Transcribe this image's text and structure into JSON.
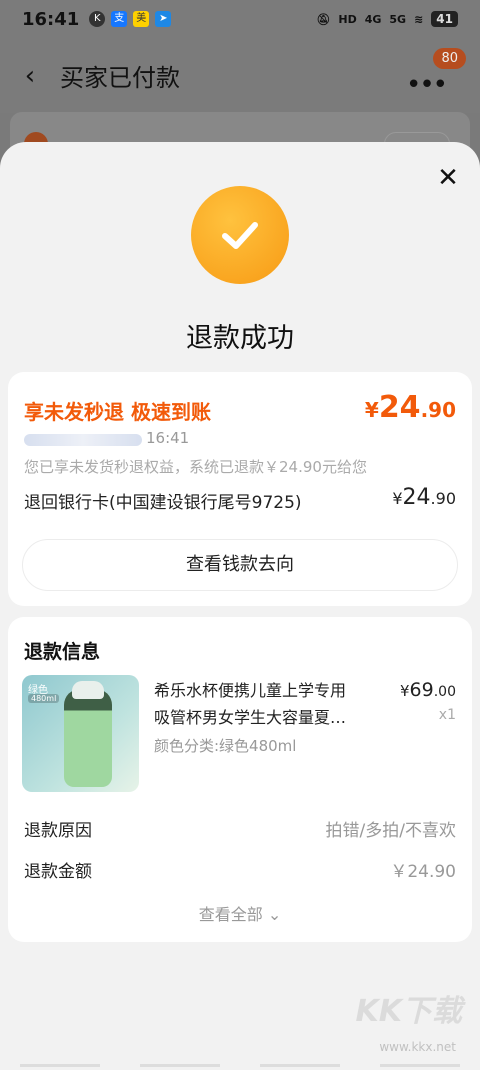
{
  "status_bar": {
    "time": "16:41",
    "battery": "41",
    "signal_labels": [
      "HD",
      "4G",
      "5G"
    ]
  },
  "header": {
    "title": "买家已付款",
    "badge": "80",
    "back_icon": "back-arrow-icon",
    "more_icon": "more-icon"
  },
  "modal": {
    "title": "退款成功",
    "close_icon": "close-icon",
    "success_icon": "checkmark-icon",
    "accent_color": "#f25a0a",
    "success_color": "#f9a21d"
  },
  "refund_card": {
    "promo": "享未发秒退 极速到账",
    "amount": {
      "currency": "¥",
      "integer": "24",
      "decimal": ".90"
    },
    "time": "16:41",
    "note": "您已享未发货秒退权益，系统已退款￥24.90元给您",
    "bank_line": "退回银行卡(中国建设银行尾号9725)",
    "bank_amount": {
      "currency": "¥",
      "integer": "24",
      "decimal": ".90"
    },
    "trace_button": "查看钱款去向"
  },
  "refund_info": {
    "title": "退款信息",
    "product": {
      "name_line1": "希乐水杯便携儿童上学专用",
      "name_line2": "吸管杯男女学生大容量夏…",
      "spec": "颜色分类:绿色480ml",
      "price": {
        "currency": "¥",
        "integer": "69",
        "decimal": ".00"
      },
      "qty": "x1",
      "img_tag": "绿色",
      "img_tag2": "480ml"
    },
    "reason_label": "退款原因",
    "reason_value": "拍错/多拍/不喜欢",
    "amount_label": "退款金额",
    "amount_value": "￥24.90",
    "view_all": "查看全部"
  },
  "watermark": {
    "text": "KK下载",
    "url": "www.kkx.net"
  }
}
